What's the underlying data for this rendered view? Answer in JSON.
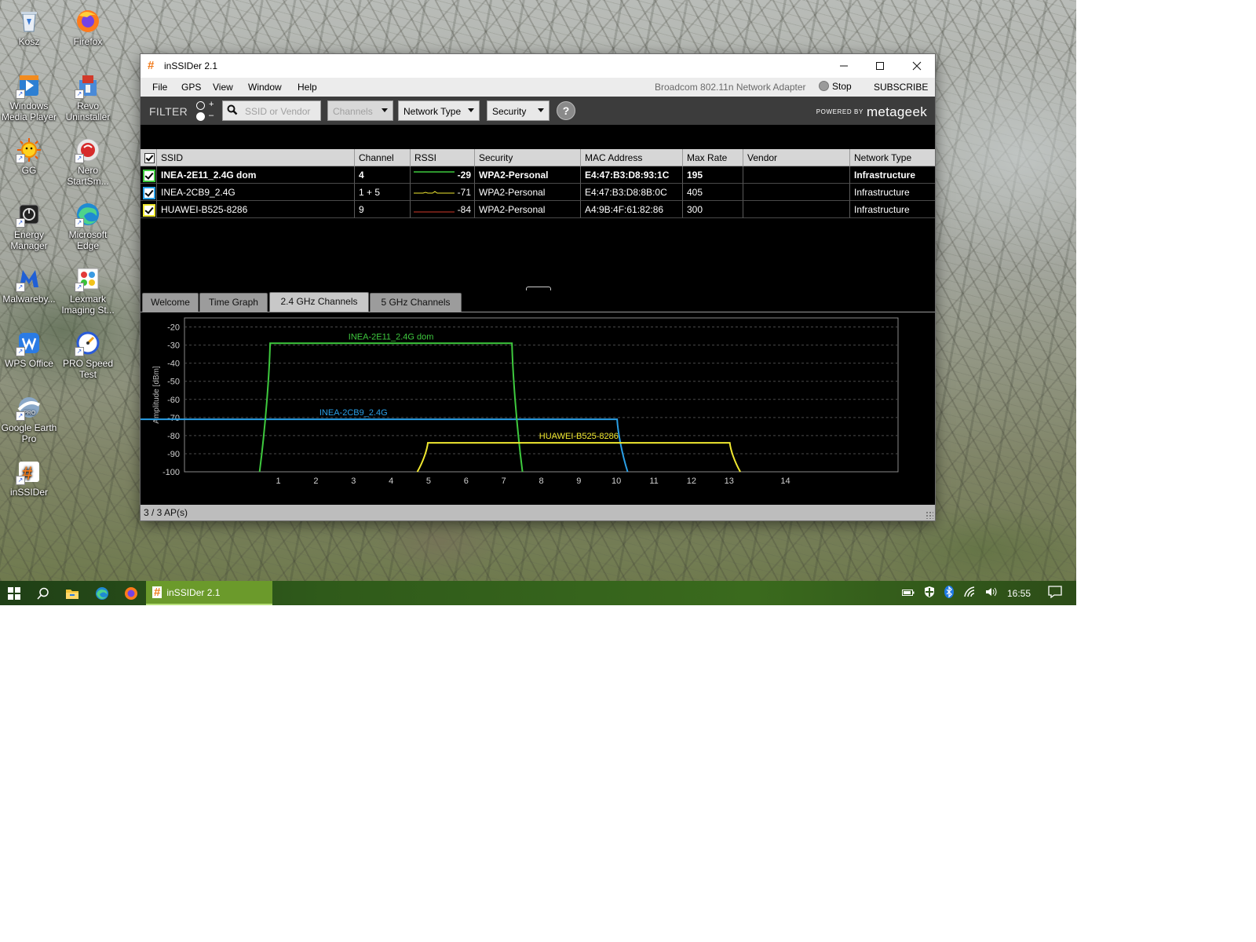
{
  "desktop": {
    "icons": [
      {
        "id": "recycle-bin",
        "label": "Kosz"
      },
      {
        "id": "firefox",
        "label": "Firefox"
      },
      {
        "id": "media-player",
        "label": "Windows Media Player"
      },
      {
        "id": "revo",
        "label": "Revo Uninstaller"
      },
      {
        "id": "gg",
        "label": "GG"
      },
      {
        "id": "nero",
        "label": "Nero StartSm..."
      },
      {
        "id": "energy",
        "label": "Energy Manager"
      },
      {
        "id": "edge",
        "label": "Microsoft Edge"
      },
      {
        "id": "malwarebytes",
        "label": "Malwareby..."
      },
      {
        "id": "lexmark",
        "label": "Lexmark Imaging St..."
      },
      {
        "id": "wps",
        "label": "WPS Office"
      },
      {
        "id": "prospeed",
        "label": "PRO Speed Test"
      },
      {
        "id": "google-earth",
        "label": "Google Earth Pro"
      },
      {
        "id": "inssider",
        "label": "inSSIDer"
      }
    ]
  },
  "window": {
    "title": "inSSIDer 2.1",
    "menu": [
      "File",
      "GPS",
      "View",
      "Window",
      "Help"
    ],
    "adapter": "Broadcom 802.11n Network Adapter",
    "stop_label": "Stop",
    "subscribe_label": "SUBSCRIBE"
  },
  "filter": {
    "label": "FILTER",
    "plus": "+",
    "minus": "–",
    "search_placeholder": "SSID or Vendor",
    "channels_label": "Channels",
    "network_type_label": "Network Type",
    "security_label": "Security",
    "help": "?",
    "powered_by": "POWERED BY",
    "brand": "metageek"
  },
  "table": {
    "columns": [
      "SSID",
      "Channel",
      "RSSI",
      "Security",
      "MAC Address",
      "Max Rate",
      "Vendor",
      "Network Type"
    ],
    "rows": [
      {
        "ssid": "INEA-2E11_2.4G dom",
        "channel": "4",
        "rssi": "-29",
        "security": "WPA2-Personal",
        "mac": "E4:47:B3:D8:93:1C",
        "max_rate": "195",
        "vendor": "",
        "network_type": "Infrastructure",
        "color": "#3ec93e"
      },
      {
        "ssid": "INEA-2CB9_2.4G",
        "channel": "1 + 5",
        "rssi": "-71",
        "security": "WPA2-Personal",
        "mac": "E4:47:B3:D8:8B:0C",
        "max_rate": "405",
        "vendor": "",
        "network_type": "Infrastructure",
        "color": "#2a9fe6"
      },
      {
        "ssid": "HUAWEI-B525-8286",
        "channel": "9",
        "rssi": "-84",
        "security": "WPA2-Personal",
        "mac": "A4:9B:4F:61:82:86",
        "max_rate": "300",
        "vendor": "",
        "network_type": "Infrastructure",
        "color": "#f0e830"
      }
    ]
  },
  "tabs": [
    "Welcome",
    "Time Graph",
    "2.4 GHz Channels",
    "5 GHz Channels"
  ],
  "active_tab": "2.4 GHz Channels",
  "chart_data": {
    "type": "line",
    "ylabel": "Amplitude [dBm]",
    "xlabel": "",
    "ylim": [
      -100,
      -15
    ],
    "xlim": [
      -1.5,
      17.5
    ],
    "yticks": [
      -20,
      -30,
      -40,
      -50,
      -60,
      -70,
      -80,
      -90,
      -100
    ],
    "xticks": [
      1,
      2,
      3,
      4,
      5,
      6,
      7,
      8,
      9,
      10,
      11,
      12,
      13,
      14
    ],
    "xtick_positions": [
      1,
      2,
      3,
      4,
      5,
      6,
      7,
      8,
      9,
      10,
      11,
      12,
      13,
      14.5
    ],
    "grid": true,
    "series": [
      {
        "name": "INEA-2CB9_2.4G",
        "color": "#2a9fe6",
        "center": 3,
        "half_width": 7.3,
        "rssi": -71
      },
      {
        "name": "INEA-2E11_2.4G dom",
        "color": "#3ec93e",
        "center": 4,
        "half_width": 3.5,
        "rssi": -29
      },
      {
        "name": "HUAWEI-B525-8286",
        "color": "#f0e830",
        "center": 9,
        "half_width": 4.3,
        "rssi": -84
      }
    ]
  },
  "status": "3 / 3 AP(s)",
  "taskbar": {
    "app_label": "inSSIDer 2.1",
    "time": "16:55"
  }
}
